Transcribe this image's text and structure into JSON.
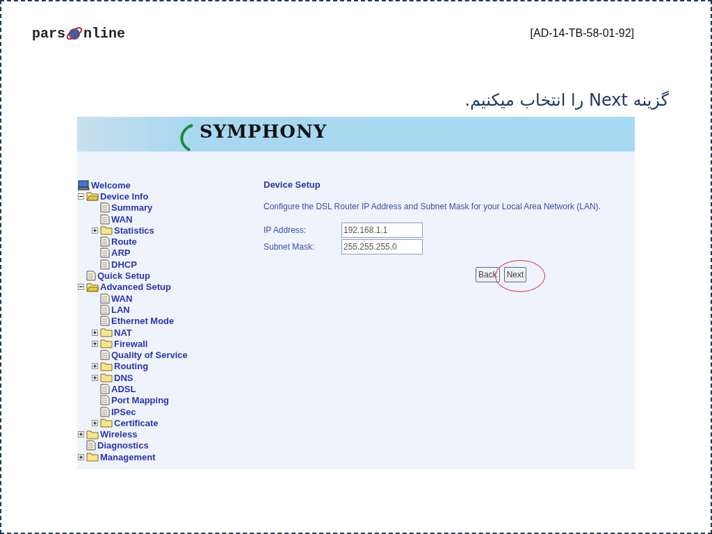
{
  "slide": {
    "logo": {
      "left": "pars",
      "right": "nline"
    },
    "code": "[AD-14-TB-58-01-92]",
    "title": "گزینه Next را انتخاب میکنیم."
  },
  "router": {
    "banner": "SYMPHONY",
    "tree": [
      {
        "label": "Welcome",
        "kind": "computer"
      },
      {
        "label": "Device Info",
        "kind": "folder",
        "expanded": true,
        "children": [
          {
            "label": "Summary",
            "kind": "page"
          },
          {
            "label": "WAN",
            "kind": "page"
          },
          {
            "label": "Statistics",
            "kind": "folder",
            "expanded": false
          },
          {
            "label": "Route",
            "kind": "page"
          },
          {
            "label": "ARP",
            "kind": "page"
          },
          {
            "label": "DHCP",
            "kind": "page"
          }
        ]
      },
      {
        "label": "Quick Setup",
        "kind": "page"
      },
      {
        "label": "Advanced Setup",
        "kind": "folder",
        "expanded": true,
        "children": [
          {
            "label": "WAN",
            "kind": "page"
          },
          {
            "label": "LAN",
            "kind": "page"
          },
          {
            "label": "Ethernet Mode",
            "kind": "page"
          },
          {
            "label": "NAT",
            "kind": "folder",
            "expanded": false
          },
          {
            "label": "Firewall",
            "kind": "folder",
            "expanded": false
          },
          {
            "label": "Quality of Service",
            "kind": "page"
          },
          {
            "label": "Routing",
            "kind": "folder",
            "expanded": false
          },
          {
            "label": "DNS",
            "kind": "folder",
            "expanded": false
          },
          {
            "label": "ADSL",
            "kind": "page"
          },
          {
            "label": "Port Mapping",
            "kind": "page"
          },
          {
            "label": "IPSec",
            "kind": "page"
          },
          {
            "label": "Certificate",
            "kind": "folder",
            "expanded": false
          }
        ]
      },
      {
        "label": "Wireless",
        "kind": "folder",
        "expanded": false
      },
      {
        "label": "Diagnostics",
        "kind": "page"
      },
      {
        "label": "Management",
        "kind": "folder",
        "expanded": false
      }
    ],
    "heading": "Device Setup",
    "description": "Configure the DSL Router IP Address and Subnet Mask for your Local Area Network (LAN).",
    "fields": [
      {
        "label": "IP Address:",
        "value": "192.168.1.1"
      },
      {
        "label": "Subnet Mask:",
        "value": "255.255.255.0"
      }
    ],
    "buttons": [
      "Back",
      "Next"
    ]
  }
}
